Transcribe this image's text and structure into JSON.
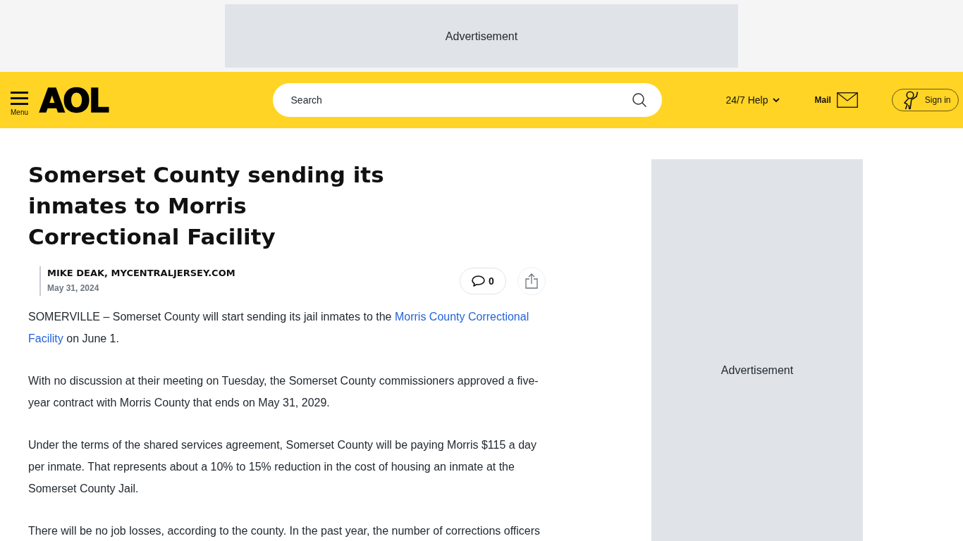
{
  "top_ad": {
    "label": "Advertisement"
  },
  "header": {
    "menu_label": "Menu",
    "logo": "AOL",
    "search": {
      "placeholder": "Search"
    },
    "help": "24/7 Help",
    "mail": "Mail",
    "sign_in": "Sign in"
  },
  "article": {
    "title": "Somerset County sending its inmates to Morris Correctional Facility",
    "author": "MIKE DEAK, MYCENTRALJERSEY.COM",
    "date": "May 31, 2024",
    "comments": "0",
    "paragraphs": [
      {
        "segments": [
          {
            "kind": "text",
            "text": "SOMERVILLE – Somerset County will start sending its jail inmates to the"
          },
          {
            "kind": "link",
            "text": "Morris County Correctional"
          },
          {
            "kind": "link",
            "text": "Facility"
          },
          {
            "kind": "text",
            "text": "on June 1."
          }
        ]
      },
      {
        "segments": [
          {
            "kind": "text",
            "text": "With no discussion at their meeting on Tuesday, the Somerset County commissioners approved a five-year contract with Morris County that ends on May 31, 2029."
          }
        ]
      },
      {
        "segments": [
          {
            "kind": "text",
            "text": "Under the terms of the shared services agreement, Somerset County will be paying Morris $115 a day per inmate. That represents about a 10% to 15% reduction in the cost of housing an inmate at the Somerset County Jail."
          }
        ]
      },
      {
        "segments": [
          {
            "kind": "text",
            "text": "There will be no job losses, according to the county. In the past year, the number of corrections officers"
          }
        ]
      }
    ]
  },
  "sidebar_ad": {
    "label": "Advertisement"
  }
}
